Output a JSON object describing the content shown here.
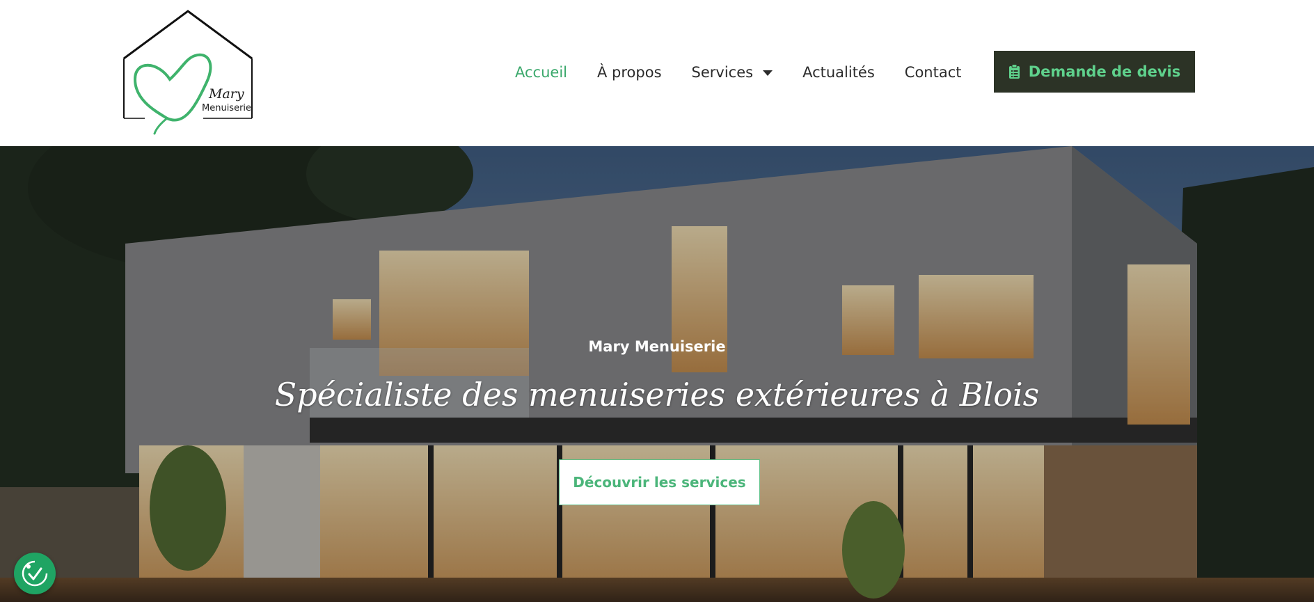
{
  "brand": {
    "logo_name": "Mary",
    "logo_subtitle": "Menuiserie",
    "accent_color": "#3aa86b",
    "dark_color": "#2c3326"
  },
  "nav": {
    "items": [
      {
        "label": "Accueil",
        "active": true
      },
      {
        "label": "À propos",
        "active": false
      },
      {
        "label": "Services",
        "active": false,
        "has_dropdown": true
      },
      {
        "label": "Actualités",
        "active": false
      },
      {
        "label": "Contact",
        "active": false
      }
    ]
  },
  "header": {
    "quote_button_label": "Demande de devis",
    "quote_button_icon": "clipboard-icon"
  },
  "hero": {
    "kicker": "Mary Menuiserie",
    "title": "Spécialiste des menuiseries extérieures à Blois",
    "cta_label": "Découvrir les services"
  },
  "accessibility": {
    "icon": "accessibility-icon"
  }
}
